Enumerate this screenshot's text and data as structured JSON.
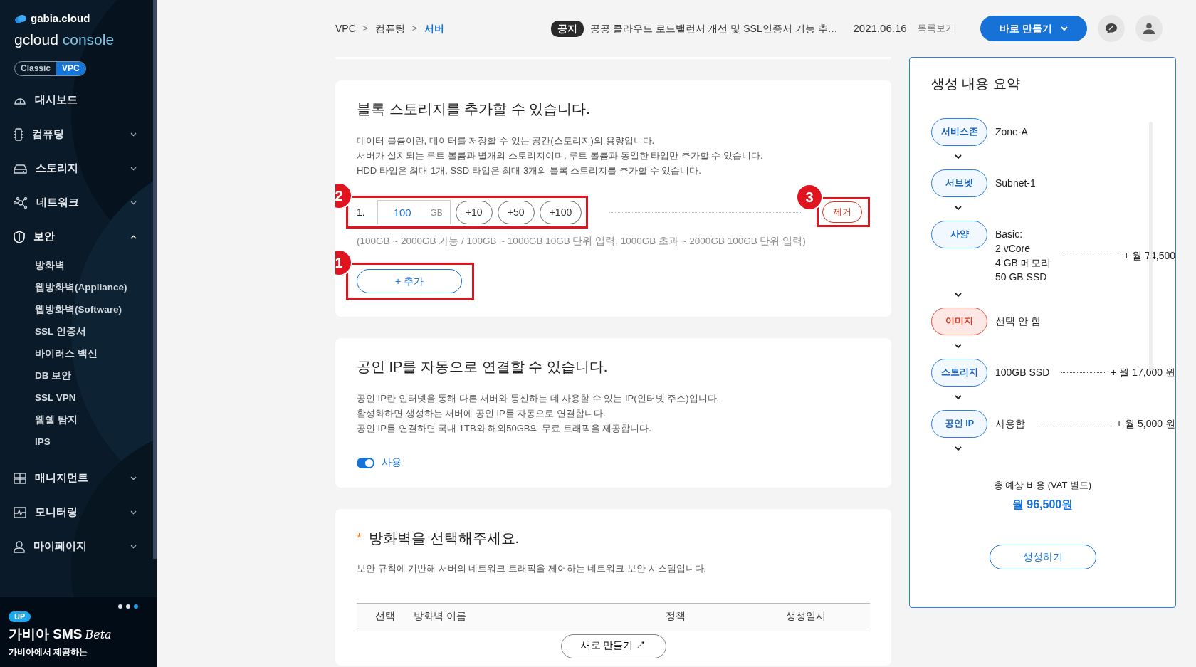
{
  "sidebar": {
    "brand": "gabia.cloud",
    "title_main": "gcloud",
    "title_accent": "console",
    "env_toggle": [
      {
        "label": "Classic",
        "selected": false
      },
      {
        "label": "VPC",
        "selected": true
      }
    ],
    "menu": [
      {
        "label": "대시보드",
        "kind": "link"
      },
      {
        "label": "컴퓨팅",
        "kind": "group",
        "expanded": false
      },
      {
        "label": "스토리지",
        "kind": "group",
        "expanded": false
      },
      {
        "label": "네트워크",
        "kind": "group",
        "expanded": false
      },
      {
        "label": "보안",
        "kind": "group",
        "expanded": true,
        "children": [
          {
            "label": "방화벽"
          },
          {
            "label": "웹방화벽(Appliance)"
          },
          {
            "label": "웹방화벽(Software)"
          },
          {
            "label": "SSL 인증서"
          },
          {
            "label": "바이러스 백신"
          },
          {
            "label": "DB 보안"
          },
          {
            "label": "SSL VPN"
          },
          {
            "label": "웹쉘 탐지"
          },
          {
            "label": "IPS"
          }
        ]
      },
      {
        "label": "매니지먼트",
        "kind": "group",
        "expanded": false
      },
      {
        "label": "모니터링",
        "kind": "group",
        "expanded": false
      },
      {
        "label": "마이페이지",
        "kind": "group",
        "expanded": false
      }
    ],
    "banner": {
      "dots": [
        {
          "selected": false
        },
        {
          "selected": false
        },
        {
          "selected": true
        }
      ],
      "badge": "UP",
      "title": "가비아 SMS",
      "title_suffix": "Beta",
      "subtitle": "가비아에서 제공하는"
    }
  },
  "header": {
    "breadcrumb": [
      {
        "label": "VPC",
        "selected": false
      },
      {
        "label": "컴퓨팅",
        "selected": false
      },
      {
        "label": "서버",
        "selected": true
      }
    ],
    "separator": ">",
    "notice": {
      "tag": "공지",
      "text": "공공 클라우드 로드밸런서 개선 및 SSL인증서 기능 추…",
      "date": "2021.06.16",
      "list_link": "목록보기"
    },
    "quick_create": "바로 만들기"
  },
  "storage": {
    "title": "블록 스토리지를 추가할 수 있습니다.",
    "description": [
      "데이터 볼륨이란, 데이터를 저장할 수 있는 공간(스토리지)의 용량입니다.",
      "서버가 설치되는 루트 볼륨과 별개의 스토리지이며, 루트 볼륨과 동일한 타입만 추가할 수 있습니다.",
      "HDD 타입은 최대 1개, SSD 타입은 최대 3개의 블록 스토리지를 추가할 수 있습니다."
    ],
    "rows": [
      {
        "index": "1.",
        "value": "100",
        "unit": "GB",
        "increments": [
          "+10",
          "+50",
          "+100"
        ],
        "remove": "제거"
      }
    ],
    "hint": "(100GB ~ 2000GB 가능 / 100GB ~ 1000GB 10GB 단위 입력, 1000GB 초과 ~ 2000GB 100GB 단위 입력)",
    "add_button": "+ 추가",
    "annotations": [
      {
        "label": "1"
      },
      {
        "label": "2"
      },
      {
        "label": "3"
      }
    ]
  },
  "public_ip": {
    "title": "공인 IP를 자동으로 연결할 수 있습니다.",
    "description": [
      "공인 IP란 인터넷을 통해 다른 서버와 통신하는 데 사용할 수 있는 IP(인터넷 주소)입니다.",
      "활성화하면 생성하는 서버에 공인 IP를 자동으로 연결합니다.",
      "공인 IP를 연결하면 국내 1TB와 해외50GB의 무료 트래픽을 제공합니다."
    ],
    "toggle": {
      "label": "사용",
      "on": true
    }
  },
  "firewall": {
    "required_mark": "*",
    "title": "방화벽을 선택해주세요.",
    "description": "보안 규칙에 기반해 서버의 네트워크 트래픽을 제어하는 네트워크 보안 시스템입니다.",
    "table": {
      "columns": [
        "선택",
        "방화벽 이름",
        "정책",
        "생성일시"
      ]
    },
    "create_button": "새로 만들기 ↗"
  },
  "summary": {
    "title": "생성 내용 요약",
    "steps": [
      {
        "label": "서비스존",
        "kind": "ok",
        "lines": [
          "Zone-A"
        ]
      },
      {
        "label": "서브넷",
        "kind": "ok",
        "lines": [
          "Subnet-1"
        ]
      },
      {
        "label": "사양",
        "kind": "ok",
        "lines": [
          "Basic:",
          "2 vCore",
          "4 GB 메모리",
          "50 GB SSD"
        ],
        "price": "+ 월 74,500"
      },
      {
        "label": "이미지",
        "kind": "missing",
        "lines": [
          "선택 안 함"
        ]
      },
      {
        "label": "스토리지",
        "kind": "ok",
        "lines": [
          "100GB SSD"
        ],
        "price": "+ 월 17,000 원"
      },
      {
        "label": "공인 IP",
        "kind": "ok",
        "lines": [
          "사용함"
        ],
        "price": "+ 월 5,000 원"
      }
    ],
    "total_label": "총 예상 비용 (VAT 별도)",
    "total": "월 96,500원",
    "submit": "생성하기"
  }
}
